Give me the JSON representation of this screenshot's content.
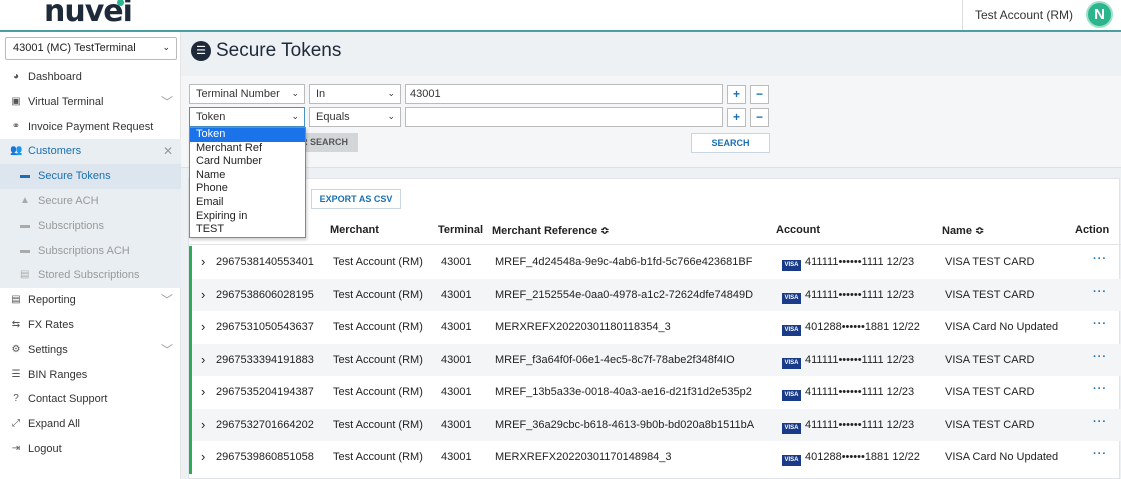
{
  "header": {
    "logo_text": "nuvei",
    "account_name": "Test Account (RM)",
    "avatar_letter": "N"
  },
  "sidebar": {
    "terminal_select": "43001 (MC) TestTerminal",
    "items": [
      {
        "label": "Dashboard",
        "icon": "dashboard-icon",
        "glyph": "◕"
      },
      {
        "label": "Virtual Terminal",
        "icon": "terminal-icon",
        "glyph": "▣",
        "caret": "﹀"
      },
      {
        "label": "Invoice Payment Request",
        "icon": "link-icon",
        "glyph": "⚭"
      },
      {
        "label": "Customers",
        "icon": "users-icon",
        "glyph": "👥",
        "caret": "✕"
      },
      {
        "label": "Reporting",
        "icon": "file-icon",
        "glyph": "▤",
        "caret": "﹀"
      },
      {
        "label": "FX Rates",
        "icon": "exchange-icon",
        "glyph": "⇆"
      },
      {
        "label": "Settings",
        "icon": "gears-icon",
        "glyph": "⚙",
        "caret": "﹀"
      },
      {
        "label": "BIN Ranges",
        "icon": "list-icon",
        "glyph": "☰"
      },
      {
        "label": "Contact Support",
        "icon": "question-icon",
        "glyph": "?"
      },
      {
        "label": "Expand All",
        "icon": "expand-icon",
        "glyph": "⤢"
      },
      {
        "label": "Logout",
        "icon": "logout-icon",
        "glyph": "⇥"
      }
    ],
    "sub_items": [
      {
        "label": "Secure Tokens",
        "icon": "card-icon",
        "glyph": "▬"
      },
      {
        "label": "Secure ACH",
        "icon": "bank-icon",
        "glyph": "▲"
      },
      {
        "label": "Subscriptions",
        "icon": "card-icon",
        "glyph": "▬"
      },
      {
        "label": "Subscriptions ACH",
        "icon": "card-icon",
        "glyph": "▬"
      },
      {
        "label": "Stored Subscriptions",
        "icon": "storage-icon",
        "glyph": "▤"
      }
    ]
  },
  "main": {
    "title": "Secure Tokens",
    "title_icon_glyph": "☰",
    "filter_rows": [
      {
        "field": "Terminal Number",
        "operator": "In",
        "value": "43001"
      },
      {
        "field": "Token",
        "operator": "Equals",
        "value": ""
      }
    ],
    "plus": "+",
    "minus": "−",
    "chevron": "⌄",
    "clear_search_visible": "R SEARCH",
    "search_label": "SEARCH",
    "export_label": "EXPORT AS CSV",
    "field_options": [
      "Token",
      "Merchant Ref",
      "Card Number",
      "Name",
      "Phone",
      "Email",
      "Expiring in",
      "TEST"
    ],
    "columns": {
      "merchant": "Merchant",
      "terminal": "Terminal",
      "merchant_reference": "Merchant Reference",
      "sort_glyph": "≎",
      "account": "Account",
      "name": "Name",
      "action": "Action"
    },
    "row_expand_glyph": "›",
    "visa_badge": "VISA",
    "action_glyph": "···",
    "rows": [
      {
        "token": "2967538140553401",
        "merchant": "Test Account (RM)",
        "terminal": "43001",
        "ref": "MREF_4d24548a-9e9c-4ab6-b1fd-5c766e423681BF",
        "card": "411111••••••1111 12/23",
        "name": "VISA TEST CARD"
      },
      {
        "token": "2967538606028195",
        "merchant": "Test Account (RM)",
        "terminal": "43001",
        "ref": "MREF_2152554e-0aa0-4978-a1c2-72624dfe74849D",
        "card": "411111••••••1111 12/23",
        "name": "VISA TEST CARD"
      },
      {
        "token": "2967531050543637",
        "merchant": "Test Account (RM)",
        "terminal": "43001",
        "ref": "MERXREFX20220301180118354_3",
        "card": "401288••••••1881 12/22",
        "name": "VISA Card No Updated"
      },
      {
        "token": "2967533394191883",
        "merchant": "Test Account (RM)",
        "terminal": "43001",
        "ref": "MREF_f3a64f0f-06e1-4ec5-8c7f-78abe2f348f4IO",
        "card": "411111••••••1111 12/23",
        "name": "VISA TEST CARD"
      },
      {
        "token": "2967535204194387",
        "merchant": "Test Account (RM)",
        "terminal": "43001",
        "ref": "MREF_13b5a33e-0018-40a3-ae16-d21f31d2e535p2",
        "card": "411111••••••1111 12/23",
        "name": "VISA TEST CARD"
      },
      {
        "token": "2967532701664202",
        "merchant": "Test Account (RM)",
        "terminal": "43001",
        "ref": "MREF_36a29cbc-b618-4613-9b0b-bd020a8b1511bA",
        "card": "411111••••••1111 12/23",
        "name": "VISA TEST CARD"
      },
      {
        "token": "2967539860851058",
        "merchant": "Test Account (RM)",
        "terminal": "43001",
        "ref": "MERXREFX20220301170148984_3",
        "card": "401288••••••1881 12/22",
        "name": "VISA Card No Updated"
      }
    ]
  }
}
